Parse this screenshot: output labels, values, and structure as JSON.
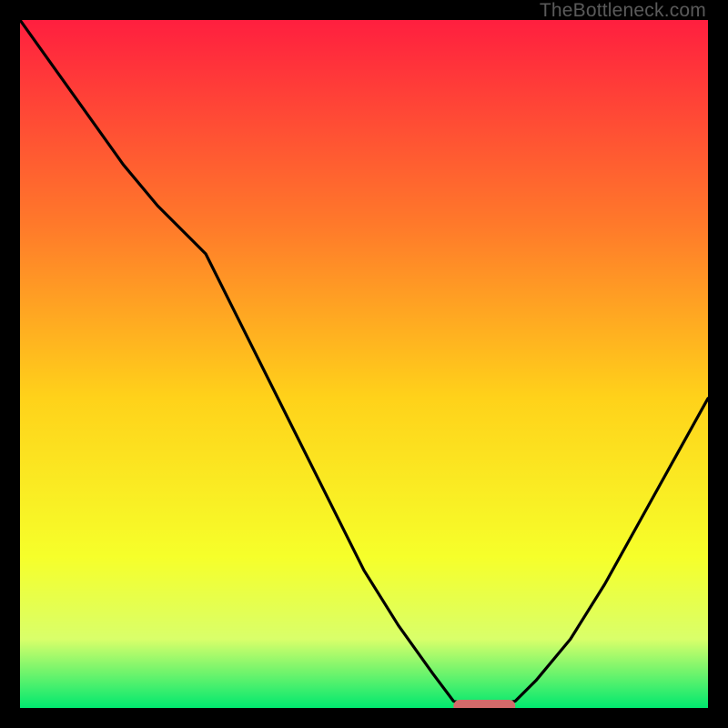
{
  "watermark": "TheBottleneck.com",
  "colors": {
    "gradient_top": "#ff1f3f",
    "gradient_upper_mid": "#ff7a2a",
    "gradient_mid": "#ffd21a",
    "gradient_lower_mid": "#f6ff2a",
    "gradient_lower": "#d9ff6a",
    "gradient_bottom": "#00e86f",
    "curve": "#000000",
    "marker": "#d36a6a",
    "background": "#000000"
  },
  "chart_data": {
    "type": "line",
    "title": "",
    "xlabel": "",
    "ylabel": "",
    "ylim": [
      0,
      100
    ],
    "x": [
      0,
      5,
      10,
      15,
      20,
      25,
      27,
      30,
      35,
      40,
      45,
      50,
      55,
      60,
      63,
      67,
      72,
      75,
      80,
      85,
      90,
      95,
      100
    ],
    "series": [
      {
        "name": "bottleneck-curve",
        "values": [
          100,
          93,
          86,
          79,
          73,
          68,
          66,
          60,
          50,
          40,
          30,
          20,
          12,
          5,
          1,
          0,
          1,
          4,
          10,
          18,
          27,
          36,
          45
        ]
      }
    ],
    "marker": {
      "x_start": 63,
      "x_end": 72,
      "y": 0
    }
  }
}
